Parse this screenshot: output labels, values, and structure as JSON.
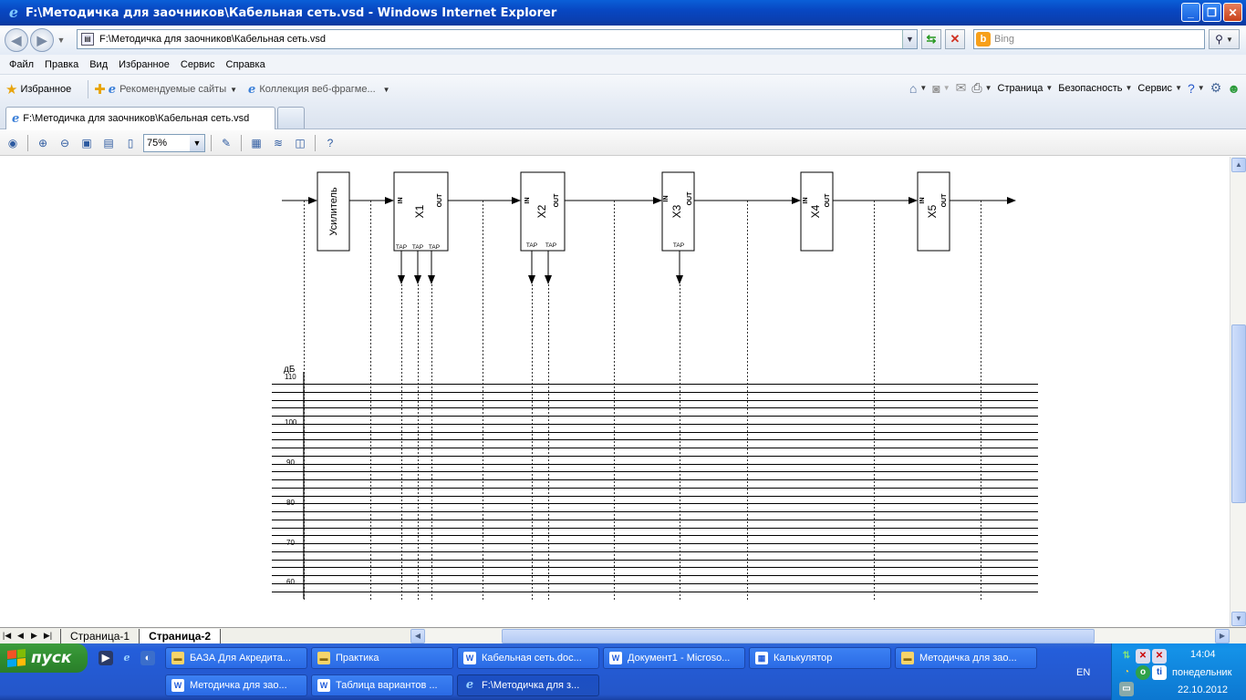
{
  "window": {
    "title": "F:\\Методичка для заочников\\Кабельная сеть.vsd - Windows Internet Explorer",
    "minimize": "_",
    "maximize": "❐",
    "close": "✕"
  },
  "address": {
    "url": "F:\\Методичка для заочников\\Кабельная сеть.vsd",
    "search_placeholder": "Bing"
  },
  "menu": [
    "Файл",
    "Правка",
    "Вид",
    "Избранное",
    "Сервис",
    "Справка"
  ],
  "favorites": {
    "label": "Избранное",
    "links": [
      "Рекомендуемые сайты",
      "Коллекция веб-фрагме..."
    ],
    "commands": [
      "Страница",
      "Безопасность",
      "Сервис"
    ]
  },
  "tab": {
    "title": "F:\\Методичка для заочников\\Кабельная сеть.vsd"
  },
  "viewer": {
    "zoom": "75%"
  },
  "diagram": {
    "amplifier_label": "Усилитель",
    "devices": [
      {
        "name": "X1",
        "in": "IN",
        "out": "OUT",
        "taps": [
          "TAP",
          "TAP",
          "TAP"
        ]
      },
      {
        "name": "X2",
        "in": "IN",
        "out": "OUT",
        "taps": [
          "TAP",
          "TAP"
        ]
      },
      {
        "name": "X3",
        "in": "IN",
        "out": "OUT",
        "taps": [
          "TAP"
        ]
      },
      {
        "name": "X4",
        "in": "IN",
        "out": "OUT",
        "taps": []
      },
      {
        "name": "X5",
        "in": "IN",
        "out": "OUT",
        "taps": []
      }
    ],
    "unit": "дБ",
    "level_labels": [
      "110",
      "100",
      "90",
      "80",
      "70",
      "60"
    ]
  },
  "pages": [
    "Страница-1",
    "Страница-2"
  ],
  "active_page": "Страница-2",
  "taskbar": {
    "start": "пуск",
    "row1": [
      "БАЗА Для Акредита...",
      "Практика",
      "Кабельная сеть.doc...",
      "Документ1 - Microso...",
      "Калькулятор",
      "Методичка для зао..."
    ],
    "row2": [
      "Методичка для зао...",
      "Таблица вариантов ...",
      "F:\\Методичка для з..."
    ],
    "lang": "EN",
    "time": "14:04",
    "day": "понедельник",
    "date": "22.10.2012"
  }
}
